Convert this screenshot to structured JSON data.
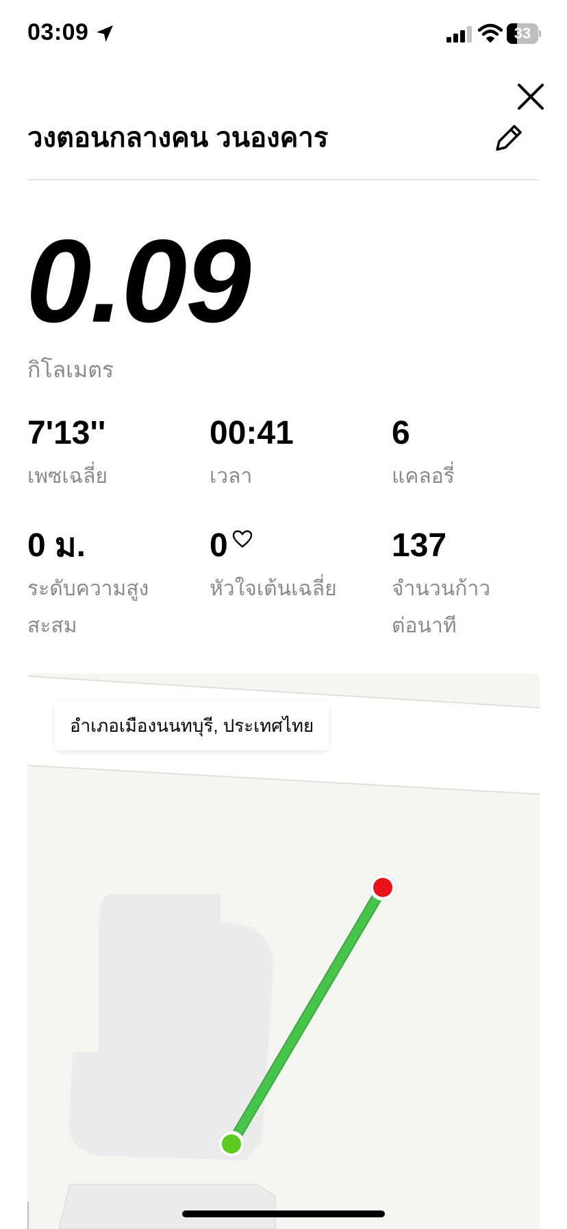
{
  "status_bar": {
    "time": "03:09",
    "battery_percent": "33",
    "battery_level": 0.33,
    "icons": [
      "location-arrow-icon",
      "cellular-signal-icon",
      "wifi-icon",
      "battery-icon"
    ]
  },
  "header": {
    "title": "วงตอนกลางคน วนองคาร",
    "close_icon": "close-icon",
    "edit_icon": "pencil-icon"
  },
  "summary": {
    "distance_value": "0.09",
    "distance_unit": "กิโลเมตร"
  },
  "stats": {
    "pace": {
      "value": "7'13''",
      "label": "เพซเฉลี่ย"
    },
    "time": {
      "value": "00:41",
      "label": "เวลา"
    },
    "calories": {
      "value": "6",
      "label": "แคลอรี่"
    },
    "elevation": {
      "value": "0 ม.",
      "label": "ระดับความสูงสะสม"
    },
    "heart_rate": {
      "value": "0",
      "label": "หัวใจเต้นเฉลี่ย",
      "icon": "heart-outline-icon"
    },
    "cadence": {
      "value": "137",
      "label": "จำนวนก้าวต่อนาที"
    }
  },
  "map": {
    "location_label": "อำเภอเมืองนนทบุรี, ประเทศไทย",
    "route_color": "#46c54a",
    "start_color": "#5ccb22",
    "end_color": "#e8131b",
    "background_color": "#f5f5f1"
  },
  "colors": {
    "text_primary": "#000000",
    "text_secondary": "#8a8a8a",
    "divider": "#e5e5e5"
  }
}
